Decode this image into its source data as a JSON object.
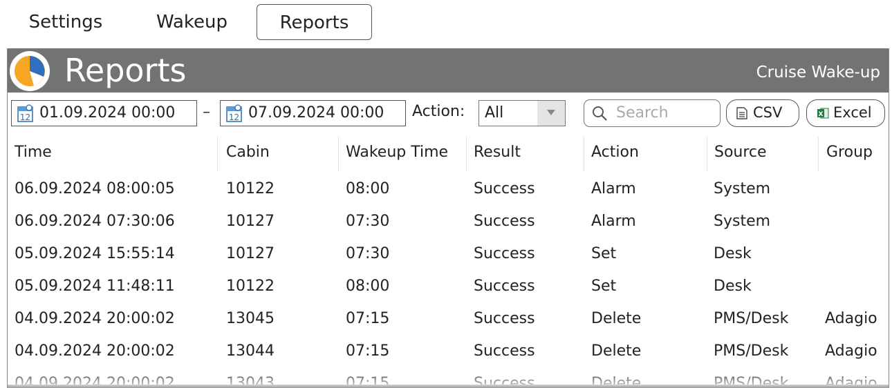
{
  "tabs": [
    "Settings",
    "Wakeup",
    "Reports"
  ],
  "header": {
    "title": "Reports",
    "brand": "Cruise Wake-up"
  },
  "filters": {
    "date_from": "01.09.2024 00:00",
    "separator": "–",
    "date_to": "07.09.2024 00:00",
    "action_label": "Action:",
    "action_value": "All",
    "search_placeholder": "Search",
    "csv_label": "CSV",
    "excel_label": "Excel"
  },
  "table": {
    "columns": [
      "Time",
      "Cabin",
      "Wakeup Time",
      "Result",
      "Action",
      "Source",
      "Group"
    ],
    "rows": [
      [
        "06.09.2024 08:00:05",
        "10122",
        "08:00",
        "Success",
        "Alarm",
        "System",
        ""
      ],
      [
        "06.09.2024 07:30:06",
        "10127",
        "07:30",
        "Success",
        "Alarm",
        "System",
        ""
      ],
      [
        "05.09.2024 15:55:14",
        "10127",
        "07:30",
        "Success",
        "Set",
        "Desk",
        ""
      ],
      [
        "05.09.2024 11:48:11",
        "10122",
        "08:00",
        "Success",
        "Set",
        "Desk",
        ""
      ],
      [
        "04.09.2024 20:00:02",
        "13045",
        "07:15",
        "Success",
        "Delete",
        "PMS/Desk",
        "Adagio"
      ],
      [
        "04.09.2024 20:00:02",
        "13044",
        "07:15",
        "Success",
        "Delete",
        "PMS/Desk",
        "Adagio"
      ],
      [
        "04.09.2024 20:00:02",
        "13043",
        "07:15",
        "Success",
        "Delete",
        "PMS/Desk",
        "Adagio"
      ]
    ]
  },
  "colors": {
    "titlebar": "#737373",
    "logo_orange": "#f5a623",
    "logo_blue": "#2f6fc0",
    "excel_green": "#1f7a3f"
  },
  "icons": [
    "reports-logo-icon",
    "calendar-icon",
    "dropdown-arrow-icon",
    "search-icon",
    "csv-file-icon",
    "excel-icon"
  ]
}
